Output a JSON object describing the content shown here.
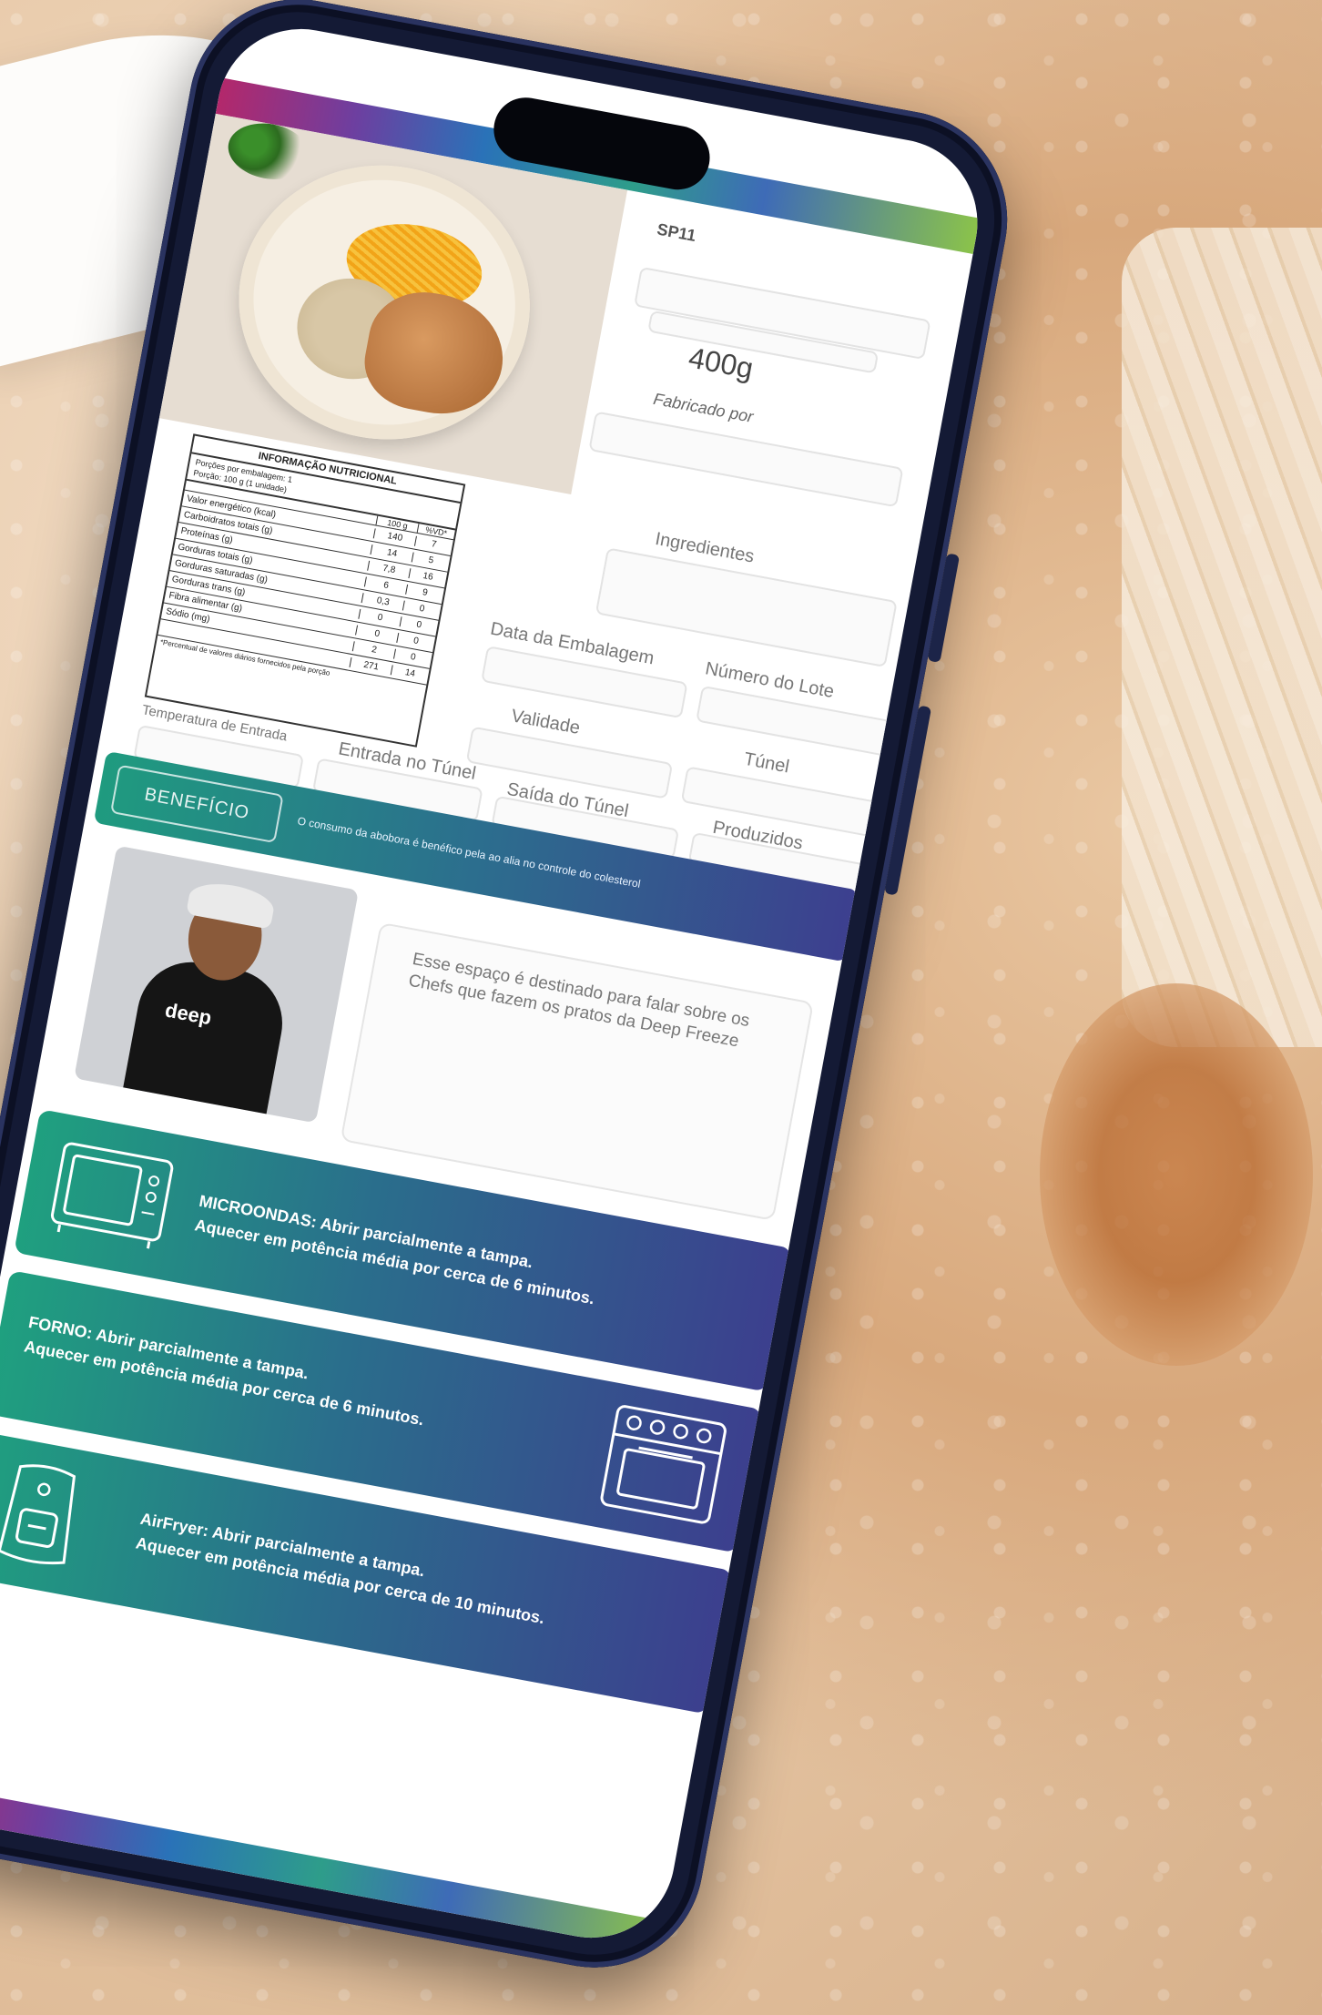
{
  "header": {
    "code": "SP11",
    "weight": "400g",
    "made_by_label": "Fabricado por"
  },
  "nutrition": {
    "title": "INFORMAÇÃO NUTRICIONAL",
    "meta_line1": "Porções por embalagem: 1",
    "meta_line2": "Porção: 100 g (1 unidade)",
    "col_100g": "100 g",
    "col_vd": "%VD*",
    "rows": [
      {
        "name": "Valor energético (kcal)",
        "a": "140",
        "b": "7"
      },
      {
        "name": "Carboidratos totais (g)",
        "a": "14",
        "b": "5"
      },
      {
        "name": "Proteínas (g)",
        "a": "7,8",
        "b": "16"
      },
      {
        "name": "Gorduras totais (g)",
        "a": "6",
        "b": "9"
      },
      {
        "name": "Gorduras saturadas (g)",
        "a": "0,3",
        "b": "0"
      },
      {
        "name": "Gorduras trans (g)",
        "a": "0",
        "b": "0"
      },
      {
        "name": "Fibra alimentar (g)",
        "a": "0",
        "b": "0"
      },
      {
        "name": "Sódio (mg)",
        "a": "2",
        "b": "0"
      },
      {
        "name": "",
        "a": "271",
        "b": "14"
      }
    ],
    "footnote": "*Percentual de valores diários fornecidos pela porção"
  },
  "labels": {
    "ingredientes": "Ingredientes",
    "data_embalagem": "Data da Embalagem",
    "numero_lote": "Número do Lote",
    "validade": "Validade",
    "tunel": "Túnel",
    "temperatura_entrada": "Temperatura de Entrada",
    "entrada_tunel": "Entrada no Túnel",
    "saida_tunel": "Saída do Túnel",
    "produzidos": "Produzidos"
  },
  "beneficio": {
    "button": "BENEFÍCIO",
    "text": "O consumo da abobora é benéfico pela ao alia no controle do colesterol"
  },
  "chef": {
    "shirt_logo": "deep",
    "description": "Esse espaço é destinado para falar sobre os Chefs que fazem os pratos da Deep Freeze"
  },
  "cooking": [
    {
      "icon": "microwave-icon",
      "line1": "MICROONDAS: Abrir parcialmente a tampa.",
      "line2": "Aquecer em potência média por cerca de 6 minutos."
    },
    {
      "icon": "oven-icon",
      "line1": "FORNO: Abrir parcialmente a tampa.",
      "line2": "Aquecer em potência média por cerca de 6 minutos."
    },
    {
      "icon": "airfryer-icon",
      "line1": "AirFryer: Abrir parcialmente a tampa.",
      "line2": "Aquecer em potência média por cerca de 10 minutos."
    }
  ],
  "colors": {
    "gradient_start": "#1fa07f",
    "gradient_end": "#3c3f8e",
    "phone_frame": "#141a35"
  }
}
